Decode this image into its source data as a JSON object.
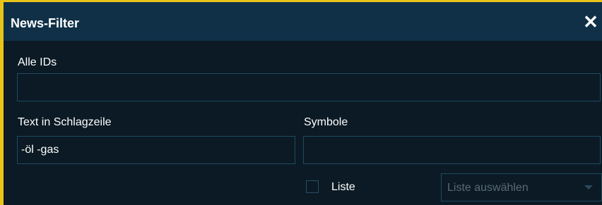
{
  "dialog": {
    "title": "News-Filter",
    "close_label": "✕"
  },
  "fields": {
    "all_ids": {
      "label": "Alle IDs",
      "value": ""
    },
    "headline_text": {
      "label": "Text in Schlagzeile",
      "value": "-öl -gas"
    },
    "symbols": {
      "label": "Symbole",
      "value": ""
    }
  },
  "list": {
    "checkbox_label": "Liste",
    "checked": false,
    "select_placeholder": "Liste auswählen"
  },
  "colors": {
    "frame_accent": "#e8c419",
    "titlebar_bg": "#0f3047",
    "body_bg": "#0b1a24",
    "field_border": "#1f4a63"
  }
}
